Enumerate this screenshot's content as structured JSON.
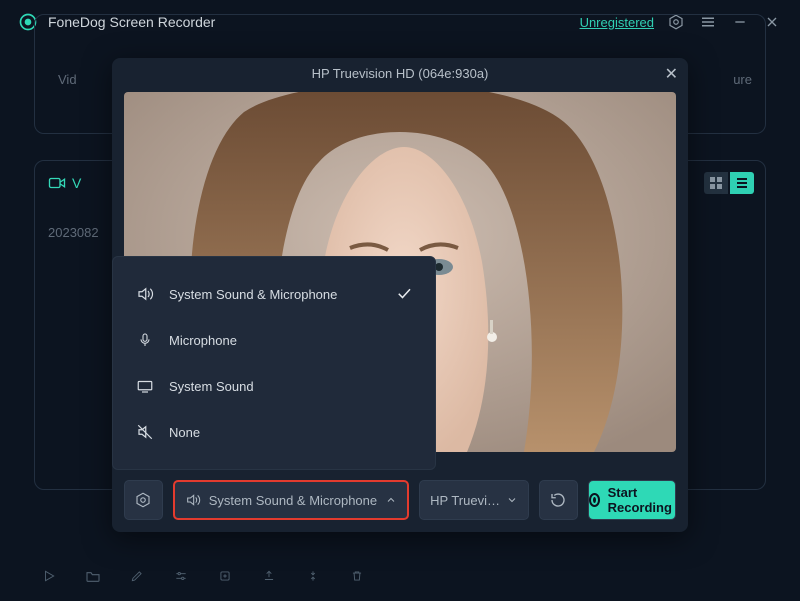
{
  "app": {
    "title": "FoneDog Screen Recorder",
    "unregistered": "Unregistered"
  },
  "background": {
    "leftLabel": "Vid",
    "rightLabel": "ure",
    "tabLabel": "V",
    "listItem": "2023082"
  },
  "modal": {
    "title": "HP Truevision HD (064e:930a)",
    "footer": {
      "audioSelected": "System Sound & Microphone",
      "cameraSelected": "HP Truevi…",
      "startLabel": "Start Recording"
    }
  },
  "audioMenu": {
    "items": [
      {
        "label": "System Sound & Microphone",
        "icon": "speaker",
        "selected": true
      },
      {
        "label": "Microphone",
        "icon": "mic",
        "selected": false
      },
      {
        "label": "System Sound",
        "icon": "system",
        "selected": false
      },
      {
        "label": "None",
        "icon": "mute",
        "selected": false
      }
    ]
  }
}
